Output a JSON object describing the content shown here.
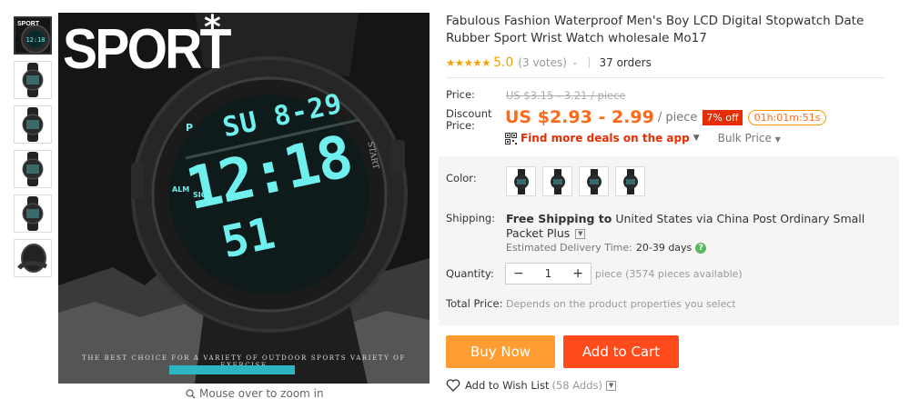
{
  "gallery": {
    "thumbnails": [
      "thumb-sport-closeup",
      "thumb-watch-front-1",
      "thumb-watch-front-2",
      "thumb-watch-front-3",
      "thumb-watch-front-4",
      "thumb-watch-side"
    ],
    "main_image": {
      "logo_text": "SPORT",
      "logo_star": "*",
      "tagline": "THE BEST CHOICE FOR A VARIETY OF OUTDOOR SPORTS VARIETY OF EXERCISE",
      "display_top": "SU 8-29",
      "display_mid": "12:18",
      "display_bottom": "51",
      "label_p": "P",
      "label_alm": "ALM",
      "label_sig": "SIG",
      "label_start": "START"
    },
    "zoom_hint": "Mouse over to zoom in"
  },
  "product": {
    "title": "Fabulous Fashion Waterproof Men's Boy LCD Digital Stopwatch Date Rubber Sport Wrist Watch wholesale Mo17",
    "stars": "★★★★★",
    "rating": "5.0",
    "votes": "(3 votes)",
    "orders": "37 orders"
  },
  "pricing": {
    "price_label": "Price:",
    "original_price": "US $3.15 - 3.21 / piece",
    "discount_label": "Discount Price:",
    "discount_price": "US $2.93 - 2.99",
    "unit": "/ piece",
    "off_badge": "7% off",
    "timer": "01h:01m:51s",
    "deals_link": "Find more deals on the app",
    "bulk_price": "Bulk Price"
  },
  "options": {
    "color_label": "Color:",
    "shipping_label": "Shipping:",
    "shipping_bold": "Free Shipping to",
    "shipping_rest": "United States via China Post Ordinary Small Packet Plus",
    "eta_label": "Estimated Delivery Time:",
    "eta_value": "20-39 days",
    "quantity_label": "Quantity:",
    "quantity_value": "1",
    "quantity_minus": "−",
    "quantity_plus": "+",
    "availability": "piece (3574 pieces available)",
    "total_label": "Total Price:",
    "total_value": "Depends on the product properties you select"
  },
  "actions": {
    "buy_now": "Buy Now",
    "add_to_cart": "Add to Cart",
    "wishlist": "Add to Wish List",
    "wishlist_count": "(58 Adds)"
  },
  "colors": {
    "accent_orange": "#ff6a1a",
    "buy_button": "#ff9d33",
    "cart_button": "#ff4a1c",
    "badge_red": "#e62e04",
    "lcd": "#6ff0ee",
    "star": "#f0a30a"
  }
}
